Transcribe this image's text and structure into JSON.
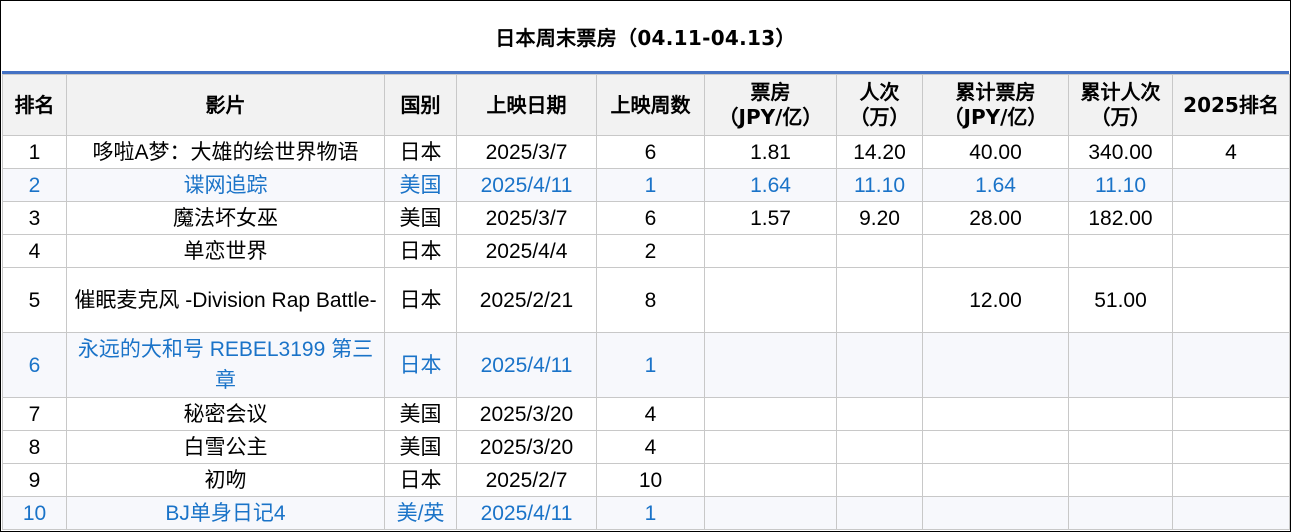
{
  "title": "日本周末票房（04.11-04.13）",
  "columns": [
    {
      "line1": "排名",
      "line2": ""
    },
    {
      "line1": "影片",
      "line2": ""
    },
    {
      "line1": "国别",
      "line2": ""
    },
    {
      "line1": "上映日期",
      "line2": ""
    },
    {
      "line1": "上映周数",
      "line2": ""
    },
    {
      "line1": "票房",
      "line2": "（JPY/亿）"
    },
    {
      "line1": "人次",
      "line2": "（万）"
    },
    {
      "line1": "累计票房",
      "line2": "（JPY/亿）"
    },
    {
      "line1": "累计人次",
      "line2": "（万）"
    },
    {
      "line1": "2025排名",
      "line2": ""
    }
  ],
  "rows": [
    {
      "rank": "1",
      "film": "哆啦A梦：大雄的绘世界物语",
      "country": "日本",
      "date": "2025/3/7",
      "weeks": "6",
      "box": "1.81",
      "adm": "14.20",
      "cum_box": "40.00",
      "cum_adm": "340.00",
      "rank2025": "4",
      "is_new": false
    },
    {
      "rank": "2",
      "film": "谍网追踪",
      "country": "美国",
      "date": "2025/4/11",
      "weeks": "1",
      "box": "1.64",
      "adm": "11.10",
      "cum_box": "1.64",
      "cum_adm": "11.10",
      "rank2025": "",
      "is_new": true
    },
    {
      "rank": "3",
      "film": "魔法坏女巫",
      "country": "美国",
      "date": "2025/3/7",
      "weeks": "6",
      "box": "1.57",
      "adm": "9.20",
      "cum_box": "28.00",
      "cum_adm": "182.00",
      "rank2025": "",
      "is_new": false
    },
    {
      "rank": "4",
      "film": "单恋世界",
      "country": "日本",
      "date": "2025/4/4",
      "weeks": "2",
      "box": "",
      "adm": "",
      "cum_box": "",
      "cum_adm": "",
      "rank2025": "",
      "is_new": false
    },
    {
      "rank": "5",
      "film": "催眠麦克风 -Division Rap Battle-",
      "country": "日本",
      "date": "2025/2/21",
      "weeks": "8",
      "box": "",
      "adm": "",
      "cum_box": "12.00",
      "cum_adm": "51.00",
      "rank2025": "",
      "is_new": false
    },
    {
      "rank": "6",
      "film": "永远的大和号 REBEL3199 第三章",
      "country": "日本",
      "date": "2025/4/11",
      "weeks": "1",
      "box": "",
      "adm": "",
      "cum_box": "",
      "cum_adm": "",
      "rank2025": "",
      "is_new": true
    },
    {
      "rank": "7",
      "film": "秘密会议",
      "country": "美国",
      "date": "2025/3/20",
      "weeks": "4",
      "box": "",
      "adm": "",
      "cum_box": "",
      "cum_adm": "",
      "rank2025": "",
      "is_new": false
    },
    {
      "rank": "8",
      "film": "白雪公主",
      "country": "美国",
      "date": "2025/3/20",
      "weeks": "4",
      "box": "",
      "adm": "",
      "cum_box": "",
      "cum_adm": "",
      "rank2025": "",
      "is_new": false
    },
    {
      "rank": "9",
      "film": "初吻",
      "country": "日本",
      "date": "2025/2/7",
      "weeks": "10",
      "box": "",
      "adm": "",
      "cum_box": "",
      "cum_adm": "",
      "rank2025": "",
      "is_new": false
    },
    {
      "rank": "10",
      "film": "BJ单身日记4",
      "country": "美/英",
      "date": "2025/4/11",
      "weeks": "1",
      "box": "",
      "adm": "",
      "cum_box": "",
      "cum_adm": "",
      "rank2025": "",
      "is_new": true
    }
  ],
  "colors": {
    "new_release_text": "#1a73c8",
    "title_underline": "#4472c4",
    "header_bg": "#f2f2f2"
  }
}
